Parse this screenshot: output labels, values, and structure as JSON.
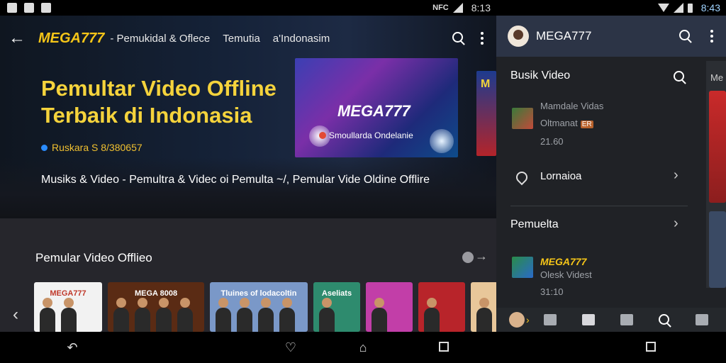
{
  "status_left": {
    "time": "8:13",
    "nfc": "NFC"
  },
  "status_right": {
    "time": "8:43"
  },
  "topbar": {
    "brand": "MEGA777",
    "subtitle": "- Pemukidal & Oflece",
    "link1": "Temutia",
    "link2": "a'Indonasim"
  },
  "hero": {
    "title": "Pemultar Video Offline Terbaik di Indonasia",
    "meta": "Ruskara S 8/380657",
    "description": "Musiks & Video - Pemultra & Videc oi Pemulta ~/, Pemular Vide Oldine Offlire",
    "stage_title": "MEGA777",
    "stage_subtitle": "Smoullarda Ondelanie",
    "side_card": "M"
  },
  "section": {
    "title": "Pemular Video Offlieo"
  },
  "thumbnails": [
    {
      "label": "MEGA777",
      "bg": "#f2f2f2",
      "fg": "#c0392b"
    },
    {
      "label": "MEGA 8008",
      "bg": "#5a2b14",
      "fg": "#ffffff"
    },
    {
      "label": "Tluines of lodacoltin",
      "bg": "#7a98c8",
      "fg": "#ffffff"
    },
    {
      "label": "Aseliats",
      "bg": "#2e8b6e",
      "fg": "#ffffff"
    },
    {
      "label": "",
      "bg": "#c23ea8",
      "fg": "#ffffff"
    },
    {
      "label": "",
      "bg": "#b8242a",
      "fg": "#ffffff"
    },
    {
      "label": "",
      "bg": "#e8c79a",
      "fg": "#333333"
    }
  ],
  "right_panel": {
    "brand": "MEGA777",
    "section1_title": "Busik Video",
    "item1_title": "Mamdale Vidas",
    "item1_sub": "Oltmanat",
    "item1_badge": "ER",
    "item1_time": "21.60",
    "item2_label": "Lornaioa",
    "section2_title": "Pemuelta",
    "item3_title": "MEGA777",
    "item3_sub": "Olesk Videst",
    "item3_time": "31:10",
    "rail_text": "Me"
  }
}
